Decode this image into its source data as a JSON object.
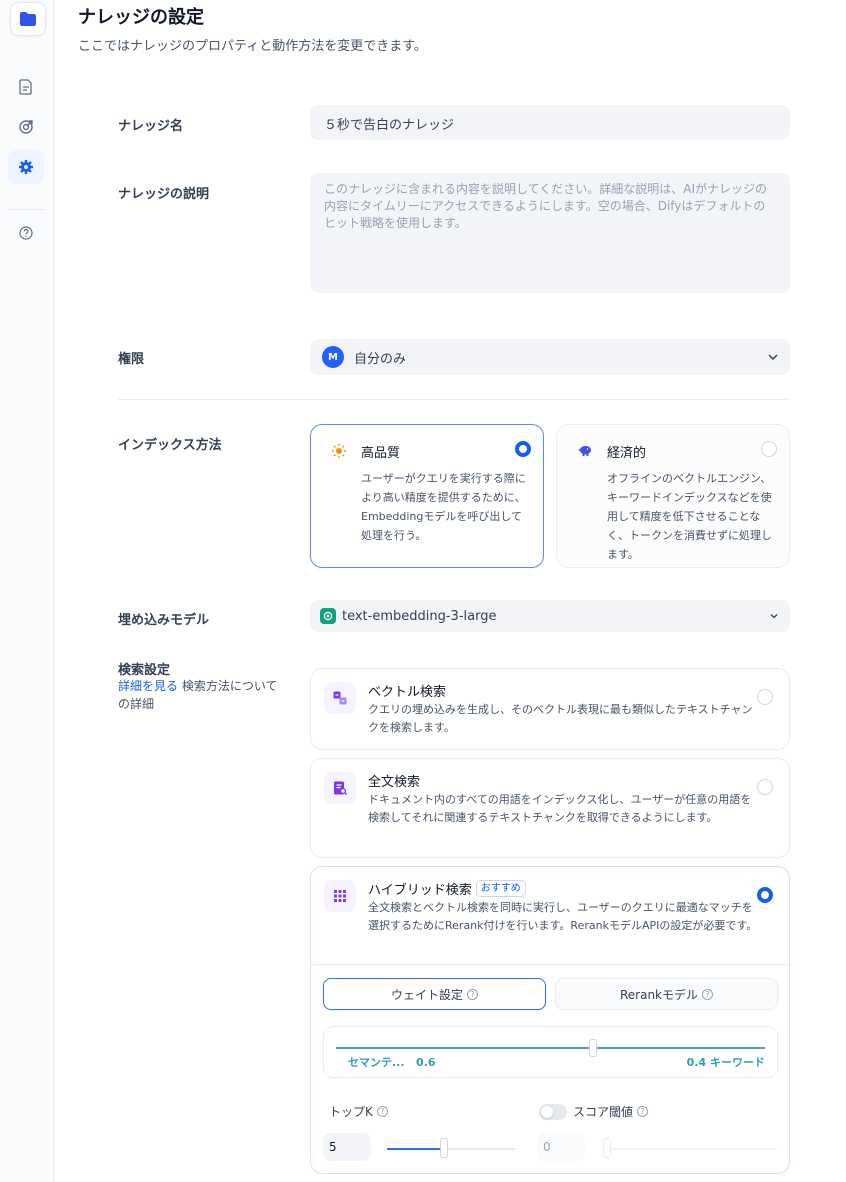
{
  "page": {
    "title": "ナレッジの設定",
    "subtitle": "ここではナレッジのプロパティと動作方法を変更できます。"
  },
  "sidebar": {
    "items": [
      {
        "icon": "folder-icon",
        "active": false
      },
      {
        "icon": "document-icon",
        "active": false
      },
      {
        "icon": "target-icon",
        "active": false
      },
      {
        "icon": "gear-icon",
        "active": true
      },
      {
        "icon": "help-icon",
        "active": false
      }
    ]
  },
  "form": {
    "name_label": "ナレッジ名",
    "name_value": "５秒で告白のナレッジ",
    "desc_label": "ナレッジの説明",
    "desc_placeholder": "このナレッジに含まれる内容を説明してください。詳細な説明は、AIがナレッジの内容にタイムリーにアクセスできるようにします。空の場合、Difyはデフォルトのヒット戦略を使用します。",
    "perm_label": "権限",
    "perm_avatar": "M",
    "perm_value": "自分のみ",
    "index_label": "インデックス方法",
    "index_options": [
      {
        "title": "高品質",
        "desc": "ユーザーがクエリを実行する際により高い精度を提供するために、Embeddingモデルを呼び出して処理を行う。",
        "selected": true
      },
      {
        "title": "経済的",
        "desc": "オフラインのベクトルエンジン、キーワードインデックスなどを使用して精度を低下させることなく、トークンを消費せずに処理します。",
        "selected": false
      }
    ],
    "embed_label": "埋め込みモデル",
    "embed_value": "text-embedding-3-large",
    "search_label": "検索設定",
    "search_link": "詳細を見る",
    "search_link_suffix": "検索方法についての詳細",
    "retrieval": [
      {
        "title": "ベクトル検索",
        "desc": "クエリの埋め込みを生成し、そのベクトル表現に最も類似したテキストチャンクを検索します。",
        "selected": false
      },
      {
        "title": "全文検索",
        "desc": "ドキュメント内のすべての用語をインデックス化し、ユーザーが任意の用語を検索してそれに関連するテキストチャンクを取得できるようにします。",
        "selected": false
      },
      {
        "title": "ハイブリッド検索",
        "badge": "おすすめ",
        "desc": "全文検索とベクトル検索を同時に実行し、ユーザーのクエリに最適なマッチを選択するためにRerank付けを行います。RerankモデルAPIの設定が必要です。",
        "selected": true
      }
    ],
    "hybrid": {
      "tab_weight": "ウェイト設定",
      "tab_rerank": "Rerankモデル",
      "weight_left": "セマンテ...",
      "weight_left_value": "0.6",
      "weight_right_value": "0.4",
      "weight_right": "キーワード",
      "topk_label": "トップK",
      "topk_value": "5",
      "score_label": "スコア閾値",
      "score_value": "0",
      "score_enabled": false
    }
  },
  "colors": {
    "accent": "#155eef",
    "teal": "#2d9fb8",
    "sidebar_active": "#eef4ff"
  }
}
